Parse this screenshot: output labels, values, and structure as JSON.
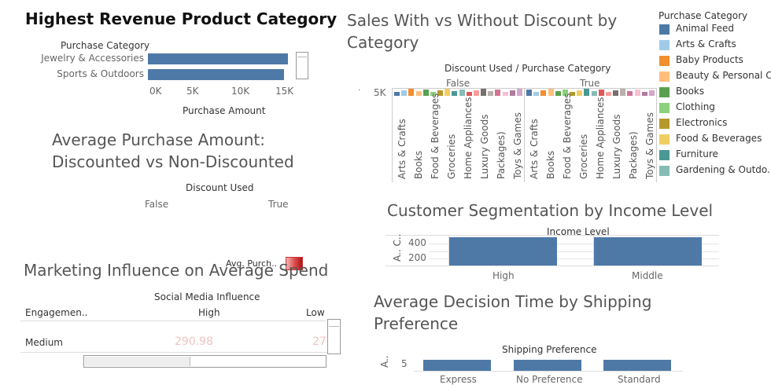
{
  "panel1": {
    "title": "Highest Revenue Product Category",
    "row_header": "Purchase Category",
    "axis_label": "Purchase Amount",
    "ticks": [
      "0K",
      "5K",
      "10K",
      "15K"
    ]
  },
  "panel2": {
    "title_line1": "Average Purchase Amount:",
    "title_line2": "Discounted vs Non-Discounted",
    "column_header": "Discount Used",
    "columns": [
      "False",
      "True"
    ]
  },
  "panel3": {
    "title": "Marketing Influence on Average Spend",
    "legend_label": "Avg. Purch..",
    "column_header": "Social Media Influence",
    "row_header": "Engagemen..",
    "columns": [
      "High",
      "Low"
    ],
    "rows": [
      {
        "label": "Medium",
        "high": "290.98",
        "low": "27"
      }
    ]
  },
  "panel4": {
    "title_line1": "Sales With vs Without Discount by",
    "title_line2": "Category",
    "header": "Discount Used  /  Purchase Category",
    "groups": [
      "False",
      "True"
    ],
    "y_tick": "5K",
    "categories": [
      "Arts & Crafts",
      "Books",
      "Food & Beverages",
      "Groceries",
      "Home Appliances",
      "Luxury Goods",
      "Packages)",
      "Toys & Games"
    ]
  },
  "legend": {
    "title": "Purchase Category",
    "items": [
      {
        "label": "Animal Feed",
        "color": "#4e79a7"
      },
      {
        "label": "Arts & Crafts",
        "color": "#a0cbe8"
      },
      {
        "label": "Baby Products",
        "color": "#f28e2b"
      },
      {
        "label": "Beauty & Personal C..",
        "color": "#ffbe7d"
      },
      {
        "label": "Books",
        "color": "#59a14f"
      },
      {
        "label": "Clothing",
        "color": "#8cd17d"
      },
      {
        "label": "Electronics",
        "color": "#b6992d"
      },
      {
        "label": "Food & Beverages",
        "color": "#f1ce63"
      },
      {
        "label": "Furniture",
        "color": "#499894"
      },
      {
        "label": "Gardening & Outdo..",
        "color": "#86bcb6"
      }
    ]
  },
  "panel5": {
    "title": "Customer Segmentation by Income Level",
    "column_header": "Income Level",
    "row_label": "A.. C..",
    "ticks": [
      "400",
      "200"
    ],
    "columns": [
      "High",
      "Middle"
    ]
  },
  "panel6": {
    "title_line1": "Average Decision Time by Shipping",
    "title_line2": "Preference",
    "column_header": "Shipping Preference",
    "row_label": "A..",
    "tick": "5",
    "columns": [
      "Express",
      "No Preference",
      "Standard"
    ]
  },
  "chart_data": [
    {
      "type": "bar",
      "title": "Highest Revenue Product Category",
      "categories": [
        "Jewelry & Accessories",
        "Sports & Outdoors"
      ],
      "values": [
        15000,
        14600
      ],
      "xlabel": "Purchase Amount",
      "ylabel": "Purchase Category",
      "xlim": [
        0,
        16000
      ]
    },
    {
      "type": "bar",
      "title": "Customer Segmentation by Income Level",
      "categories": [
        "High",
        "Middle"
      ],
      "values": [
        450,
        450
      ],
      "xlabel": "Income Level",
      "ylim": [
        0,
        480
      ]
    },
    {
      "type": "bar",
      "title": "Average Decision Time by Shipping Preference",
      "categories": [
        "Express",
        "No Preference",
        "Standard"
      ],
      "values": [
        6.5,
        6.5,
        6.5
      ],
      "xlabel": "Shipping Preference",
      "ylim": [
        0,
        7
      ]
    }
  ]
}
